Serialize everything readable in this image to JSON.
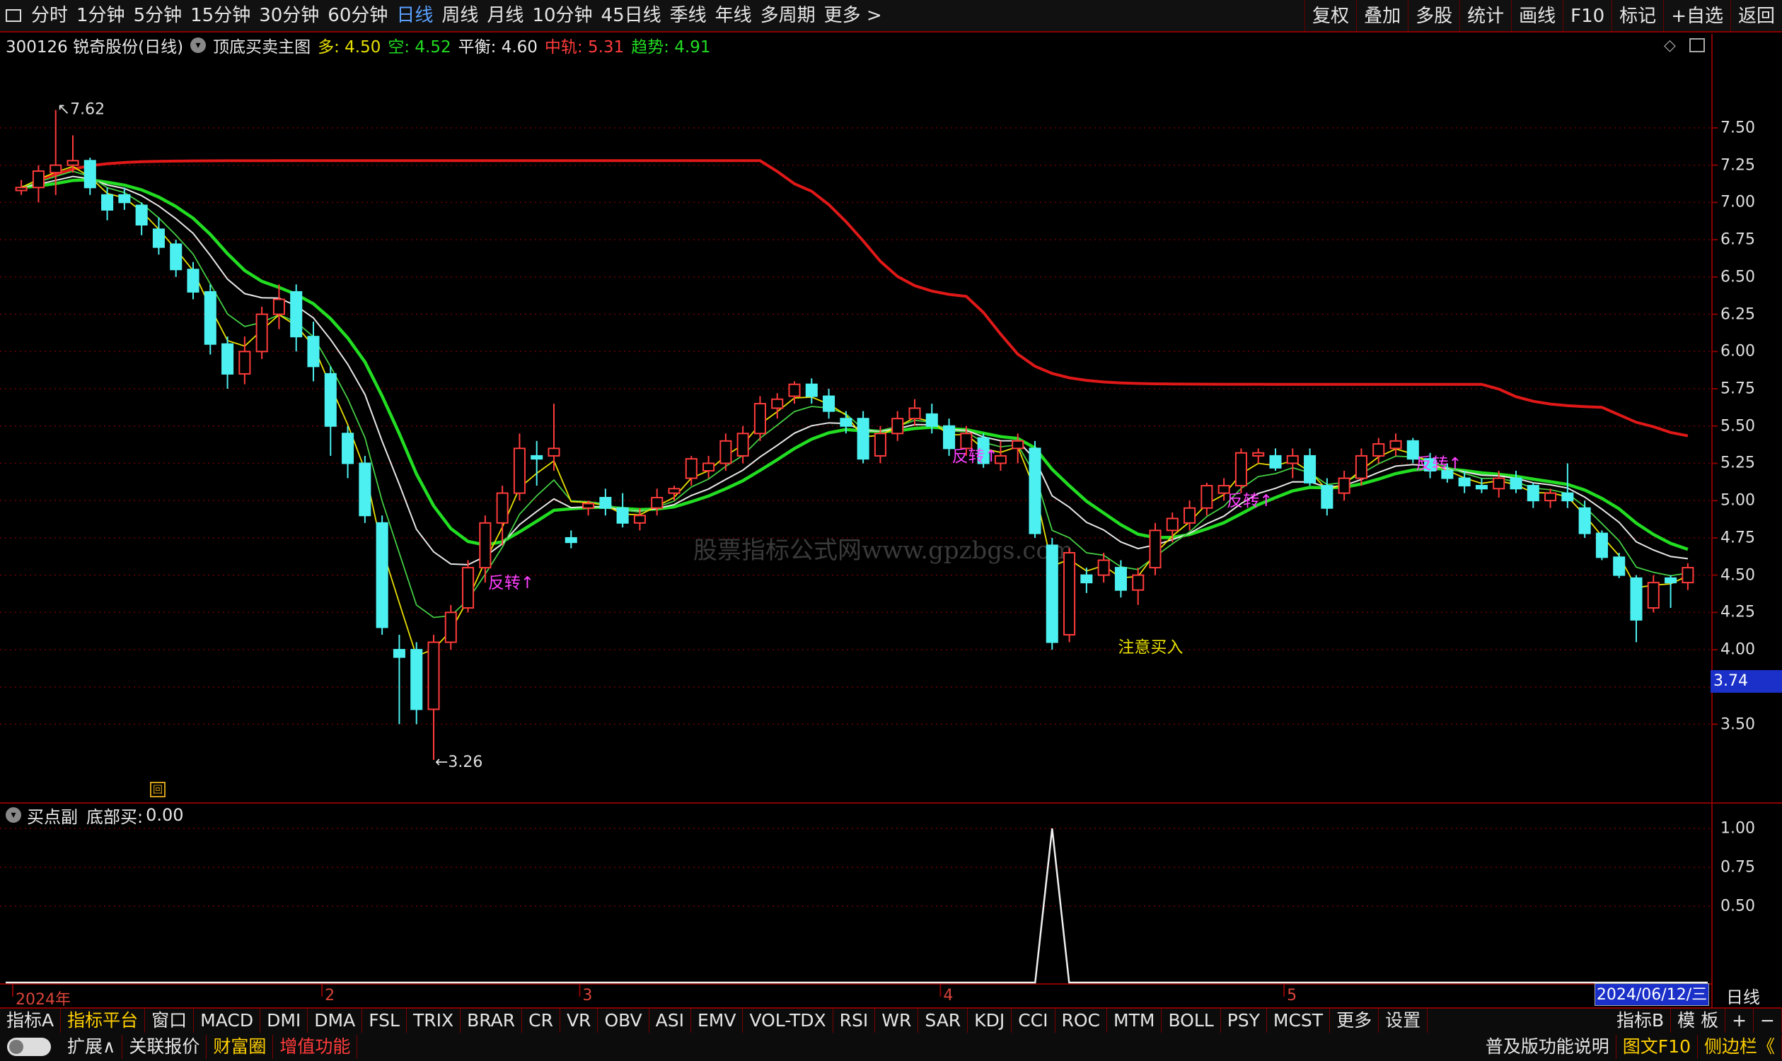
{
  "top_tabs": [
    "分时",
    "1分钟",
    "5分钟",
    "15分钟",
    "30分钟",
    "60分钟",
    "日线",
    "周线",
    "月线",
    "10分钟",
    "45日线",
    "季线",
    "年线",
    "多周期",
    "更多 >"
  ],
  "active_tab": "日线",
  "right_tools": [
    "复权",
    "叠加",
    "多股",
    "统计",
    "画线",
    "F10",
    "标记",
    "+自选",
    "返回"
  ],
  "stock": {
    "code_name": "300126 锐奇股份(日线)",
    "indicator": "顶底买卖主图",
    "duo_label": "多:",
    "duo_val": "4.50",
    "kong_label": "空:",
    "kong_val": "4.52",
    "pingheng_label": "平衡:",
    "pingheng_val": "4.60",
    "zhonggui_label": "中轨:",
    "zhonggui_val": "5.31",
    "qushi_label": "趋势:",
    "qushi_val": "4.91"
  },
  "colors": {
    "up": "#ff3b3b",
    "down": "#4df0f0",
    "red_line": "#e01818",
    "green_line": "#22dd22",
    "white_line": "#e8e8e8",
    "yellow_line": "#e8e000",
    "magenta": "#ff40ff",
    "grid": "#8a0000",
    "date_box": "#1a30c8"
  },
  "main_axis": {
    "ticks": [
      "7.50",
      "7.25",
      "7.00",
      "6.75",
      "6.50",
      "6.25",
      "6.00",
      "5.75",
      "5.50",
      "5.25",
      "5.00",
      "4.75",
      "4.50",
      "4.25",
      "4.00",
      "3.75",
      "3.50"
    ],
    "tick_values": [
      7.5,
      7.25,
      7.0,
      6.75,
      6.5,
      6.25,
      6.0,
      5.75,
      5.5,
      5.25,
      5.0,
      4.75,
      4.5,
      4.25,
      4.0,
      3.75,
      3.5
    ],
    "range": [
      3.0,
      7.95
    ]
  },
  "current_price": "3.74",
  "annotations": {
    "high": "7.62",
    "low": "3.26",
    "reversals": [
      {
        "text": "反转↑",
        "bar": 27
      },
      {
        "text": "反转↑",
        "bar": 54
      },
      {
        "text": "反转↑",
        "bar": 70
      },
      {
        "text": "反转↑",
        "bar": 81
      }
    ],
    "buy_note": "注意买入",
    "buy_bar": 64
  },
  "sub_panel": {
    "title": "买点副",
    "label": "底部买:",
    "value": "0.00",
    "ticks": [
      "1.00",
      "0.75",
      "0.50"
    ],
    "tick_values": [
      1.0,
      0.75,
      0.5
    ],
    "range": [
      0,
      1.1
    ],
    "spike_bar": 64
  },
  "x_axis": {
    "labels": [
      {
        "text": "2024年",
        "bar": 0
      },
      {
        "text": "2",
        "bar": 18
      },
      {
        "text": "3",
        "bar": 33
      },
      {
        "text": "4",
        "bar": 54
      },
      {
        "text": "5",
        "bar": 74
      }
    ],
    "date": "2024/06/12/三",
    "period": "日线"
  },
  "bottom_tabs": [
    "指标A",
    "指标平台",
    "窗口",
    "MACD",
    "DMI",
    "DMA",
    "FSL",
    "TRIX",
    "BRAR",
    "CR",
    "VR",
    "OBV",
    "ASI",
    "EMV",
    "VOL-TDX",
    "RSI",
    "WR",
    "SAR",
    "KDJ",
    "CCI",
    "ROC",
    "MTM",
    "BOLL",
    "PSY",
    "MCST",
    "更多",
    "设置"
  ],
  "bottom_right": [
    "指标B",
    "模 板",
    "+",
    "−"
  ],
  "footer_left": [
    "扩展∧",
    "关联报价",
    "财富圈",
    "增值功能"
  ],
  "footer_right": [
    "普及版功能说明",
    "图文F10",
    "侧边栏《"
  ],
  "watermark": "股票指标公式网www.gpzbgs.com",
  "chart_data": {
    "type": "candlestick",
    "series": [
      {
        "name": "candles",
        "ohlc": [
          [
            7.08,
            7.15,
            7.05,
            7.1
          ],
          [
            7.1,
            7.25,
            7.0,
            7.21
          ],
          [
            7.2,
            7.62,
            7.05,
            7.25
          ],
          [
            7.25,
            7.45,
            7.2,
            7.28
          ],
          [
            7.28,
            7.3,
            7.05,
            7.1
          ],
          [
            7.05,
            7.1,
            6.88,
            6.95
          ],
          [
            7.05,
            7.1,
            6.95,
            7.0
          ],
          [
            6.98,
            7.0,
            6.78,
            6.85
          ],
          [
            6.82,
            6.9,
            6.65,
            6.7
          ],
          [
            6.72,
            6.75,
            6.5,
            6.55
          ],
          [
            6.55,
            6.6,
            6.35,
            6.4
          ],
          [
            6.4,
            6.45,
            5.98,
            6.05
          ],
          [
            6.05,
            6.1,
            5.75,
            5.85
          ],
          [
            5.85,
            6.1,
            5.78,
            6.0
          ],
          [
            6.0,
            6.3,
            5.95,
            6.25
          ],
          [
            6.25,
            6.45,
            6.15,
            6.35
          ],
          [
            6.4,
            6.45,
            6.0,
            6.1
          ],
          [
            6.1,
            6.2,
            5.8,
            5.9
          ],
          [
            5.85,
            5.9,
            5.3,
            5.5
          ],
          [
            5.45,
            5.5,
            5.15,
            5.25
          ],
          [
            5.25,
            5.3,
            4.85,
            4.9
          ],
          [
            4.85,
            4.9,
            4.1,
            4.15
          ],
          [
            4.0,
            4.1,
            3.5,
            3.95
          ],
          [
            4.0,
            4.05,
            3.5,
            3.6
          ],
          [
            3.6,
            4.1,
            3.26,
            4.05
          ],
          [
            4.05,
            4.3,
            4.0,
            4.25
          ],
          [
            4.28,
            4.6,
            4.25,
            4.55
          ],
          [
            4.55,
            4.9,
            4.45,
            4.85
          ],
          [
            4.85,
            5.1,
            4.7,
            5.05
          ],
          [
            5.05,
            5.45,
            5.0,
            5.35
          ],
          [
            5.3,
            5.4,
            5.1,
            5.28
          ],
          [
            5.3,
            5.65,
            5.2,
            5.35
          ],
          [
            4.75,
            4.8,
            4.68,
            4.72
          ],
          [
            4.95,
            5.0,
            4.9,
            4.98
          ],
          [
            5.02,
            5.08,
            4.9,
            4.95
          ],
          [
            4.95,
            5.05,
            4.82,
            4.85
          ],
          [
            4.85,
            4.95,
            4.8,
            4.9
          ],
          [
            4.95,
            5.08,
            4.9,
            5.02
          ],
          [
            5.05,
            5.1,
            5.0,
            5.08
          ],
          [
            5.15,
            5.3,
            5.1,
            5.28
          ],
          [
            5.2,
            5.3,
            5.15,
            5.25
          ],
          [
            5.25,
            5.45,
            5.2,
            5.4
          ],
          [
            5.3,
            5.5,
            5.25,
            5.45
          ],
          [
            5.45,
            5.7,
            5.4,
            5.65
          ],
          [
            5.62,
            5.72,
            5.55,
            5.68
          ],
          [
            5.7,
            5.8,
            5.65,
            5.78
          ],
          [
            5.78,
            5.82,
            5.65,
            5.7
          ],
          [
            5.7,
            5.75,
            5.55,
            5.6
          ],
          [
            5.55,
            5.6,
            5.45,
            5.5
          ],
          [
            5.55,
            5.6,
            5.25,
            5.28
          ],
          [
            5.3,
            5.5,
            5.25,
            5.45
          ],
          [
            5.45,
            5.6,
            5.4,
            5.55
          ],
          [
            5.55,
            5.68,
            5.5,
            5.62
          ],
          [
            5.58,
            5.65,
            5.45,
            5.5
          ],
          [
            5.5,
            5.55,
            5.3,
            5.35
          ],
          [
            5.35,
            5.5,
            5.3,
            5.45
          ],
          [
            5.42,
            5.45,
            5.22,
            5.25
          ],
          [
            5.25,
            5.4,
            5.2,
            5.3
          ],
          [
            5.35,
            5.45,
            5.25,
            5.4
          ],
          [
            5.35,
            5.4,
            4.75,
            4.78
          ],
          [
            4.7,
            4.75,
            4.0,
            4.05
          ],
          [
            4.1,
            4.68,
            4.05,
            4.65
          ],
          [
            4.5,
            4.55,
            4.38,
            4.45
          ],
          [
            4.5,
            4.65,
            4.45,
            4.6
          ],
          [
            4.55,
            4.6,
            4.35,
            4.4
          ],
          [
            4.4,
            4.55,
            4.3,
            4.5
          ],
          [
            4.55,
            4.85,
            4.5,
            4.8
          ],
          [
            4.8,
            4.92,
            4.72,
            4.88
          ],
          [
            4.85,
            5.0,
            4.8,
            4.95
          ],
          [
            4.95,
            5.12,
            4.9,
            5.1
          ],
          [
            5.05,
            5.15,
            5.0,
            5.1
          ],
          [
            5.1,
            5.35,
            5.05,
            5.32
          ],
          [
            5.3,
            5.35,
            5.25,
            5.32
          ],
          [
            5.3,
            5.35,
            5.2,
            5.22
          ],
          [
            5.25,
            5.35,
            5.15,
            5.3
          ],
          [
            5.3,
            5.35,
            5.1,
            5.12
          ],
          [
            5.1,
            5.15,
            4.9,
            4.95
          ],
          [
            5.05,
            5.2,
            5.0,
            5.15
          ],
          [
            5.15,
            5.35,
            5.1,
            5.3
          ],
          [
            5.3,
            5.42,
            5.25,
            5.38
          ],
          [
            5.35,
            5.45,
            5.3,
            5.4
          ],
          [
            5.4,
            5.42,
            5.25,
            5.28
          ],
          [
            5.28,
            5.32,
            5.15,
            5.2
          ],
          [
            5.2,
            5.25,
            5.12,
            5.15
          ],
          [
            5.15,
            5.2,
            5.05,
            5.1
          ],
          [
            5.1,
            5.15,
            5.05,
            5.08
          ],
          [
            5.08,
            5.2,
            5.02,
            5.15
          ],
          [
            5.15,
            5.2,
            5.05,
            5.08
          ],
          [
            5.1,
            5.12,
            4.95,
            5.0
          ],
          [
            5.0,
            5.08,
            4.95,
            5.05
          ],
          [
            5.05,
            5.25,
            4.95,
            5.0
          ],
          [
            4.95,
            5.0,
            4.75,
            4.78
          ],
          [
            4.78,
            4.8,
            4.6,
            4.62
          ],
          [
            4.62,
            4.65,
            4.48,
            4.5
          ],
          [
            4.48,
            4.5,
            4.05,
            4.2
          ],
          [
            4.28,
            4.5,
            4.25,
            4.45
          ],
          [
            4.48,
            4.5,
            4.28,
            4.45
          ],
          [
            4.45,
            4.58,
            4.4,
            4.55
          ]
        ]
      },
      {
        "name": "red_line"
      },
      {
        "name": "green_line"
      },
      {
        "name": "white_line"
      },
      {
        "name": "yellow_line"
      },
      {
        "name": "green_thin"
      }
    ]
  }
}
